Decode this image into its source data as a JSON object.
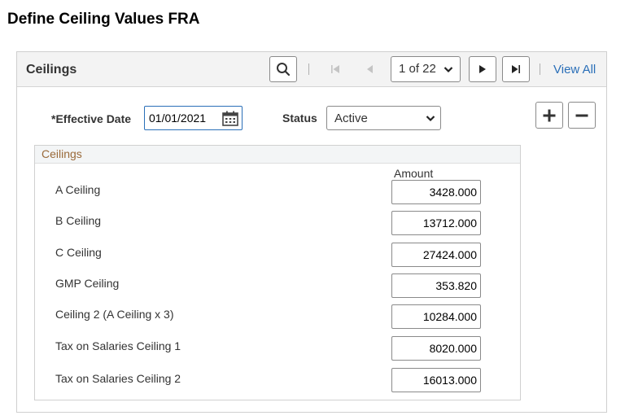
{
  "page": {
    "title": "Define Ceiling Values FRA"
  },
  "panel": {
    "title": "Ceilings",
    "pagination": {
      "current": "1 of 22"
    },
    "view_all_label": "View All"
  },
  "form": {
    "effective_date_label": "*Effective Date",
    "effective_date_value": "01/01/2021",
    "status_label": "Status",
    "status_value": "Active"
  },
  "ceilings_group": {
    "title": "Ceilings",
    "amount_header": "Amount",
    "rows": [
      {
        "label": "A Ceiling",
        "amount": "3428.000"
      },
      {
        "label": "B Ceiling",
        "amount": "13712.000"
      },
      {
        "label": "C Ceiling",
        "amount": "27424.000"
      },
      {
        "label": "GMP Ceiling",
        "amount": "353.820"
      },
      {
        "label": "Ceiling 2 (A Ceiling x 3)",
        "amount": "10284.000"
      },
      {
        "label": "Tax on Salaries Ceiling 1",
        "amount": "8020.000"
      },
      {
        "label": "Tax on Salaries Ceiling 2",
        "amount": "16013.000"
      }
    ]
  },
  "icons": [
    "search-icon",
    "first-page-icon",
    "previous-page-icon",
    "chevron-down-icon",
    "next-page-icon",
    "last-page-icon",
    "calendar-icon",
    "add-row-icon",
    "delete-row-icon"
  ],
  "colors": {
    "link": "#2a6fb8",
    "group_title": "#9a6a3a",
    "focus_border": "#2a6fb8"
  }
}
